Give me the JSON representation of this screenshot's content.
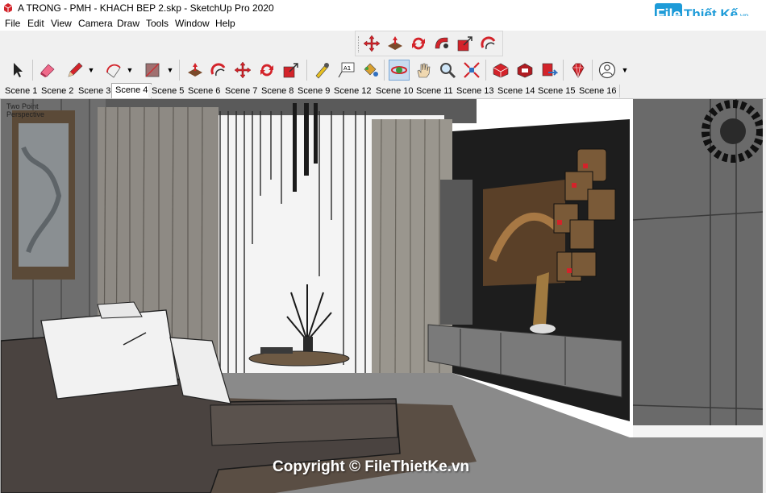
{
  "window": {
    "title": "A TRONG - PMH - KHACH BEP 2.skp - SketchUp Pro 2020"
  },
  "brand": {
    "file": "File",
    "rest": "Thiết Kế",
    "domain": ".vn"
  },
  "menu": {
    "items": [
      {
        "label": "File",
        "key": "file"
      },
      {
        "label": "Edit",
        "key": "edit"
      },
      {
        "label": "View",
        "key": "view"
      },
      {
        "label": "Camera",
        "key": "camera"
      },
      {
        "label": "Draw",
        "key": "draw"
      },
      {
        "label": "Tools",
        "key": "tools"
      },
      {
        "label": "Window",
        "key": "window"
      },
      {
        "label": "Help",
        "key": "help"
      }
    ]
  },
  "scenes": {
    "active_index": 3,
    "tabs": [
      "Scene 1",
      "Scene 2",
      "Scene 3",
      "Scene 4",
      "Scene 5",
      "Scene 6",
      "Scene 7",
      "Scene 8",
      "Scene 9",
      "Scene 12",
      "Scene 10",
      "Scene 11",
      "Scene 13",
      "Scene 14",
      "Scene 15",
      "Scene 16"
    ]
  },
  "viewport": {
    "camera_label_line1": "Two Point",
    "camera_label_line2": "Perspective"
  },
  "watermark": {
    "text": "Copyright © FileThietKe.vn"
  },
  "colors": {
    "accent": "#1d9bd8",
    "tool_red": "#d3232a",
    "active_tool_bg": "#c8dcf0"
  }
}
